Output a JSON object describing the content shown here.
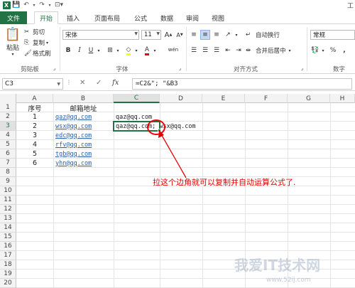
{
  "window": {
    "title_partial": "工",
    "app_logo": "X"
  },
  "tabs": [
    "文件",
    "开始",
    "插入",
    "页面布局",
    "公式",
    "数据",
    "审阅",
    "视图"
  ],
  "ribbon": {
    "clipboard": {
      "paste": "粘贴",
      "cut": "剪切",
      "copy": "复制",
      "format_painter": "格式刷",
      "label": "剪贴板"
    },
    "font": {
      "name": "宋体",
      "size": "11",
      "grow": "A",
      "shrink": "A",
      "bold": "B",
      "italic": "I",
      "underline": "U",
      "font_color": "A",
      "phonetic": "wén",
      "label": "字体"
    },
    "alignment": {
      "wrap_text": "自动换行",
      "merge_center": "合并后居中",
      "label": "对齐方式"
    },
    "number": {
      "format": "常规",
      "percent": "%",
      "comma": ",",
      "label": "数字"
    }
  },
  "formula_bar": {
    "name_box": "C3",
    "cancel": "✕",
    "enter": "✓",
    "fx": "fx",
    "formula": "=C2&\"; \"&B3"
  },
  "columns": [
    "A",
    "B",
    "C",
    "D",
    "E",
    "F",
    "G",
    "H"
  ],
  "rows": [
    "1",
    "2",
    "3",
    "4",
    "5",
    "6",
    "7",
    "8",
    "9",
    "10",
    "11",
    "12",
    "13",
    "14",
    "15",
    "16",
    "17",
    "18",
    "19",
    "20"
  ],
  "cells": {
    "A1": "序号",
    "B1": "邮箱地址",
    "A2": "1",
    "A3": "2",
    "A4": "3",
    "A5": "4",
    "A6": "5",
    "A7": "6",
    "B2": "qaz@qq.com",
    "B3": "wsx@qq.com",
    "B4": "edc@qq.com",
    "B5": "rfv@qq.com",
    "B6": "tgb@qq.com",
    "B7": "yhn@qq.com",
    "C2": "qaz@qq.com",
    "C3": "qaz@qq.com; wsx@qq.com"
  },
  "annotation": "拉这个边角就可以复制并自动运算公式了.",
  "watermark": {
    "main": "我爱IT技术网",
    "url": "www.52ij.com"
  },
  "colors": {
    "excel_green": "#217346",
    "annotation_red": "#e10000",
    "link_blue": "#2b5fa8"
  }
}
